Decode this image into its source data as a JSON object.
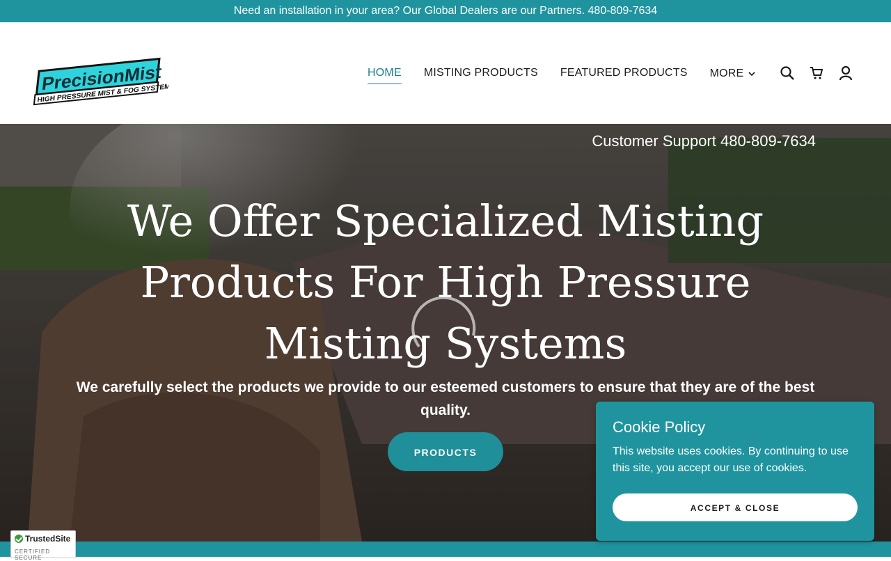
{
  "announcement": "Need an installation in your area? Our Global Dealers are our Partners. 480-809-7634",
  "logo": {
    "line1": "PrecisionMist",
    "line2": "HIGH PRESSURE MIST & FOG SYSTEMS"
  },
  "nav": {
    "home": "HOME",
    "misting_products": "MISTING PRODUCTS",
    "featured_products": "FEATURED PRODUCTS",
    "more": "MORE"
  },
  "icons": [
    "search-icon",
    "cart-icon",
    "account-icon",
    "chevron-down-icon",
    "loading-spinner-icon",
    "check-icon"
  ],
  "hero": {
    "support": "Customer Support 480-809-7634",
    "headline": "We Offer Specialized Misting Products For High Pressure Misting Systems",
    "subtext": "We carefully select the products we provide to our esteemed customers to ensure that they are of the best quality.",
    "button": "PRODUCTS"
  },
  "cookie": {
    "title": "Cookie Policy",
    "body": "This website uses cookies. By continuing to use this site, you accept our use of cookies.",
    "button": "ACCEPT & CLOSE"
  },
  "trusted_site": {
    "name": "TrustedSite",
    "sub": "CERTIFIED SECURE"
  },
  "colors": {
    "brand": "#1f949f",
    "nav_active": "#1a7f8a",
    "text": "#1b1b1b"
  }
}
